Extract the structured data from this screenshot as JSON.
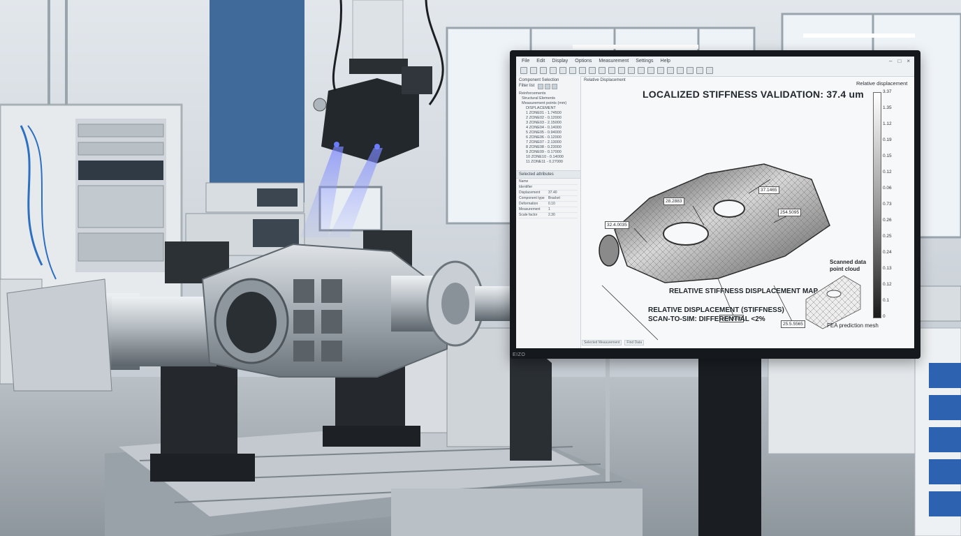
{
  "monitor": {
    "brand": "EIZO",
    "menu": [
      "File",
      "Edit",
      "Display",
      "Options",
      "Measurement",
      "Settings",
      "Help"
    ],
    "window_controls": [
      "–",
      "□",
      "×"
    ],
    "left_panel": {
      "title": "Component Selection",
      "search_label": "Filter list",
      "tree": [
        {
          "label": "Reinforcements",
          "level": 0
        },
        {
          "label": "Structural Elements",
          "level": 1
        },
        {
          "label": "Measurement points (mm)",
          "level": 1
        },
        {
          "label": "DISPLACEMENT",
          "level": 2
        },
        {
          "label": "1 ZONE01 - 1.74500",
          "level": 2
        },
        {
          "label": "2 ZONE02 - 0.12000",
          "level": 2
        },
        {
          "label": "3 ZONE03 - 2.15000",
          "level": 2
        },
        {
          "label": "4 ZONE04 - 0.14000",
          "level": 2
        },
        {
          "label": "5 ZONE05 - 0.94000",
          "level": 2
        },
        {
          "label": "6 ZONE06 - 0.12000",
          "level": 2
        },
        {
          "label": "7 ZONE07 - 2.13000",
          "level": 2
        },
        {
          "label": "8 ZONE08 - 0.23000",
          "level": 2
        },
        {
          "label": "9 ZONE09 - 0.17000",
          "level": 2
        },
        {
          "label": "10 ZONE10 - 0.14000",
          "level": 2
        },
        {
          "label": "11 ZONE11 - 0.27000",
          "level": 2
        }
      ],
      "properties_title": "Selected attributes",
      "properties": [
        {
          "k": "Name",
          "v": ""
        },
        {
          "k": "Identifier",
          "v": ""
        },
        {
          "k": "Displacement",
          "v": "37.40"
        },
        {
          "k": "Component type",
          "v": "Bracket"
        },
        {
          "k": "Deformation",
          "v": "0.10"
        },
        {
          "k": "Measurement",
          "v": "1"
        },
        {
          "k": "Scale factor",
          "v": "2.30"
        }
      ]
    },
    "status_tabs": [
      "Selected Measurement",
      "Find Data"
    ],
    "viewport": {
      "label": "Relative Displacement",
      "title": "LOCALIZED STIFFNESS VALIDATION: 37.4 um",
      "legend_title": "Relative displacement",
      "ticks": [
        "3.37",
        "1.35",
        "1.12",
        "0.19",
        "0.15",
        "0.12",
        "0.06",
        "0.73",
        "0.26",
        "0.25",
        "0.24",
        "0.13",
        "0.12",
        "0.1",
        "0"
      ],
      "callouts": {
        "c1": "37.1465",
        "c2": "28.2883",
        "c3": "254.5095",
        "c4": "32.4.0035",
        "c5": "33.6.9206",
        "c6": "25.5.5565"
      },
      "caption_main": "RELATIVE STIFFNESS DISPLACEMENT MAP",
      "caption_sub1": "RELATIVE DISPLACEMENT (STIFFNESS)",
      "caption_sub2": "SCAN-TO-SIM: DIFFERENTIAL <2%",
      "scan_label": "Scanned data point cloud",
      "fea_label": "FEA prediction mesh"
    }
  },
  "colors": {
    "lab_wall": "#d6dde4",
    "blue_column": "#3f6a99",
    "laser": "#6b7cff",
    "monitor_bezel": "#15191d",
    "steel": "#b7bec5"
  }
}
